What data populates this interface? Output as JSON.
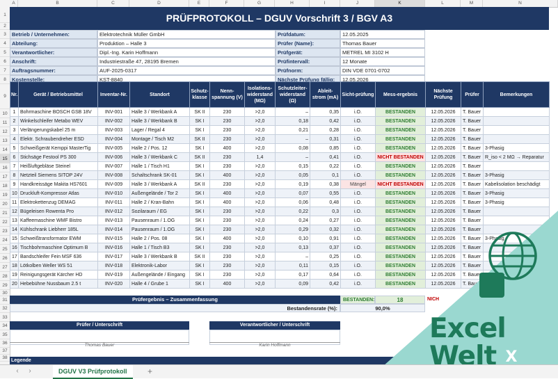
{
  "columns": [
    "A",
    "B",
    "C",
    "D",
    "E",
    "F",
    "G",
    "H",
    "I",
    "J",
    "K",
    "L",
    "M",
    "N"
  ],
  "selected_column": "K",
  "rows": [
    "1",
    "2",
    "3",
    "4",
    "5",
    "6",
    "7",
    "8",
    "9",
    "10",
    "11",
    "12",
    "13",
    "14",
    "15",
    "16",
    "17",
    "18",
    "19",
    "20",
    "21",
    "22",
    "23",
    "24",
    "25",
    "26",
    "27",
    "28",
    "29",
    "30",
    "31",
    "32",
    "33",
    "34",
    "35",
    "36",
    "37",
    "38"
  ],
  "selected_row": "15",
  "title": "PRÜFPROTOKOLL – DGUV Vorschrift 3 / BGV A3",
  "info_left": [
    {
      "label": "Betrieb / Unternehmen:",
      "value": "Elektrotechnik Müller GmbH"
    },
    {
      "label": "Abteilung:",
      "value": "Produktion – Halle 3"
    },
    {
      "label": "Verantwortlicher:",
      "value": "Dipl.-Ing. Karin Hoffmann"
    },
    {
      "label": "Anschrift:",
      "value": "Industriestraße 47, 28195 Bremen"
    },
    {
      "label": "Auftragsnummer:",
      "value": "AUF-2025-0317"
    },
    {
      "label": "Kostenstelle:",
      "value": "KST-8840"
    }
  ],
  "info_right": [
    {
      "label": "Prüfdatum:",
      "value": "12.05.2025"
    },
    {
      "label": "Prüfer (Name):",
      "value": "Thomas Bauer"
    },
    {
      "label": "Prüfgerät:",
      "value": "METREL MI 3102 H"
    },
    {
      "label": "Prüfintervall:",
      "value": "12 Monate"
    },
    {
      "label": "Prüfnorm:",
      "value": "DIN VDE 0701-0702"
    },
    {
      "label": "Nächste Prüfung fällig:",
      "value": "12.05.2026"
    }
  ],
  "table_headers": [
    "Nr.",
    "Gerät / Betriebsmittel",
    "Inventar-Nr.",
    "Standort",
    "Schutz-klasse",
    "Nenn-spannung (V)",
    "Isolations-widerstand (MΩ)",
    "Schutzleiter-widerstand (Ω)",
    "Ableit-strom (mA)",
    "Sicht-prüfung",
    "Mess-ergebnis",
    "Nächste Prüfung",
    "Prüfer",
    "Bemerkungen"
  ],
  "table_rows": [
    [
      "1",
      "Bohrmaschine BOSCH GSB 18V",
      "INV-001",
      "Halle 3 / Werkbank A",
      "SK II",
      "230",
      ">2,0",
      "–",
      "0,35",
      "i.O.",
      "BESTANDEN",
      "12.05.2026",
      "T. Bauer",
      ""
    ],
    [
      "2",
      "Winkelschleifer Metabo WEV",
      "INV-002",
      "Halle 3 / Werkbank B",
      "SK I",
      "230",
      ">2,0",
      "0,18",
      "0,42",
      "i.O.",
      "BESTANDEN",
      "12.05.2026",
      "T. Bauer",
      ""
    ],
    [
      "3",
      "Verlängerungskabel 25 m",
      "INV-003",
      "Lager / Regal 4",
      "SK I",
      "230",
      ">2,0",
      "0,21",
      "0,28",
      "i.O.",
      "BESTANDEN",
      "12.05.2026",
      "T. Bauer",
      ""
    ],
    [
      "4",
      "Elektr. Schraubendreher ESD",
      "INV-004",
      "Montage / Tisch M2",
      "SK II",
      "230",
      ">2,0",
      "–",
      "0,31",
      "i.O.",
      "BESTANDEN",
      "12.05.2026",
      "T. Bauer",
      ""
    ],
    [
      "5",
      "Schweißgerät Kemppi MasterTig",
      "INV-005",
      "Halle 2 / Pos. 12",
      "SK I",
      "400",
      ">2,0",
      "0,08",
      "0,85",
      "i.O.",
      "BESTANDEN",
      "12.05.2026",
      "T. Bauer",
      "3-Phasig"
    ],
    [
      "6",
      "Stichsäge Festool PS 300",
      "INV-006",
      "Halle 3 / Werkbank C",
      "SK II",
      "230",
      "1,4",
      "–",
      "0,41",
      "i.O.",
      "NICHT BESTANDEN",
      "12.05.2026",
      "T. Bauer",
      "R_iso < 2 MΩ → Reparatur"
    ],
    [
      "7",
      "Heißluftgebläse Steinel",
      "INV-007",
      "Halle 1 / Tisch H1",
      "SK I",
      "230",
      ">2,0",
      "0,15",
      "0,22",
      "i.O.",
      "BESTANDEN",
      "12.05.2026",
      "T. Bauer",
      ""
    ],
    [
      "8",
      "Netzteil Siemens SITOP 24V",
      "INV-008",
      "Schaltschrank SK-01",
      "SK I",
      "400",
      ">2,0",
      "0,05",
      "0,1",
      "i.O.",
      "BESTANDEN",
      "12.05.2026",
      "T. Bauer",
      "3-Phasig"
    ],
    [
      "9",
      "Handkreissäge Makita HS7601",
      "INV-009",
      "Halle 3 / Werkbank A",
      "SK II",
      "230",
      ">2,0",
      "0,19",
      "0,38",
      "Mängel",
      "NICHT BESTANDEN",
      "12.05.2026",
      "T. Bauer",
      "Kabelisolation beschädigt"
    ],
    [
      "10",
      "Druckluft-Kompressor Atlas",
      "INV-010",
      "Außengelände / Tor 2",
      "SK I",
      "400",
      ">2,0",
      "0,07",
      "0,55",
      "i.O.",
      "BESTANDEN",
      "12.05.2026",
      "T. Bauer",
      "3-Phasig"
    ],
    [
      "11",
      "Elektrokettenzug DEMAG",
      "INV-011",
      "Halle 2 / Kran-Bahn",
      "SK I",
      "400",
      ">2,0",
      "0,06",
      "0,48",
      "i.O.",
      "BESTANDEN",
      "12.05.2026",
      "T. Bauer",
      "3-Phasig"
    ],
    [
      "12",
      "Bügeleisen Rowenta Pro",
      "INV-012",
      "Sozilaraum / EG",
      "SK I",
      "230",
      ">2,0",
      "0,22",
      "0,3",
      "i.O.",
      "BESTANDEN",
      "12.05.2026",
      "T. Bauer",
      ""
    ],
    [
      "13",
      "Kaffeemaschine WMF Bistro",
      "INV-013",
      "Pausenraum / 1.OG",
      "SK I",
      "230",
      ">2,0",
      "0,24",
      "0,27",
      "i.O.",
      "BESTANDEN",
      "12.05.2026",
      "T. Bauer",
      ""
    ],
    [
      "14",
      "Kühlschrank Liebherr 185L",
      "INV-014",
      "Pausenraum / 1.OG",
      "SK I",
      "230",
      ">2,0",
      "0,29",
      "0,32",
      "i.O.",
      "BESTANDEN",
      "12.05.2026",
      "T. Bauer",
      ""
    ],
    [
      "15",
      "Schweißtransformator EWM",
      "INV-015",
      "Halle 2 / Pos. 08",
      "SK I",
      "400",
      ">2,0",
      "0,10",
      "0,91",
      "i.O.",
      "BESTANDEN",
      "12.05.2026",
      "T. Bauer",
      "3-Phasig"
    ],
    [
      "16",
      "Tischbohrmaschine Optimum B",
      "INV-016",
      "Halle 1 / Tisch B3",
      "SK I",
      "230",
      ">2,0",
      "0,13",
      "0,37",
      "i.O.",
      "BESTANDEN",
      "12.05.2026",
      "T. Bauer",
      ""
    ],
    [
      "17",
      "Bandschleifer Fein MSF 636",
      "INV-017",
      "Halle 3 / Werkbank B",
      "SK II",
      "230",
      ">2,0",
      "–",
      "0,25",
      "i.O.",
      "BESTANDEN",
      "12.05.2026",
      "T. Bauer",
      ""
    ],
    [
      "18",
      "Lötkolben Weller WS 51",
      "INV-018",
      "Elektronik-Labor",
      "SK I",
      "230",
      ">2,0",
      "0,11",
      "0,15",
      "i.O.",
      "BESTANDEN",
      "12.05.2026",
      "T. Bauer",
      ""
    ],
    [
      "19",
      "Reinigungsgerät Kärcher HD",
      "INV-019",
      "Außengelände / Eingang",
      "SK I",
      "230",
      ">2,0",
      "0,17",
      "0,64",
      "i.O.",
      "BESTANDEN",
      "12.05.2026",
      "T. Bauer",
      ""
    ],
    [
      "20",
      "Hebebühne Nussbaum 2.5 t",
      "INV-020",
      "Halle 4 / Grube 1",
      "SK I",
      "400",
      ">2,0",
      "0,09",
      "0,42",
      "i.O.",
      "BESTANDEN",
      "12.05.2026",
      "T. Bauer",
      ""
    ]
  ],
  "summary": {
    "header": "Prüfergebnis – Zusammenfassung",
    "passed_label": "BESTANDEN:",
    "passed_value": "18",
    "failed_label_partial": "NICH",
    "rate_label": "Bestandensrate (%):",
    "rate_value": "90,0%"
  },
  "signatures": {
    "inspector_header": "Prüfer / Unterschrift",
    "inspector_name": "Thomas Bauer",
    "responsible_header": "Verantwortlicher / Unterschrift",
    "responsible_name": "Karin Hoffmann"
  },
  "legend_label": "Legende",
  "sheet_tab": "DGUV V3 Prüfprotokoll",
  "nav_prev": "‹",
  "nav_next": "›",
  "add_sheet": "+",
  "logo": {
    "line1": "Excel",
    "line2": "Welt",
    "badge": "X",
    "teal": "#9ad8d0",
    "green": "#1e7a5a"
  }
}
